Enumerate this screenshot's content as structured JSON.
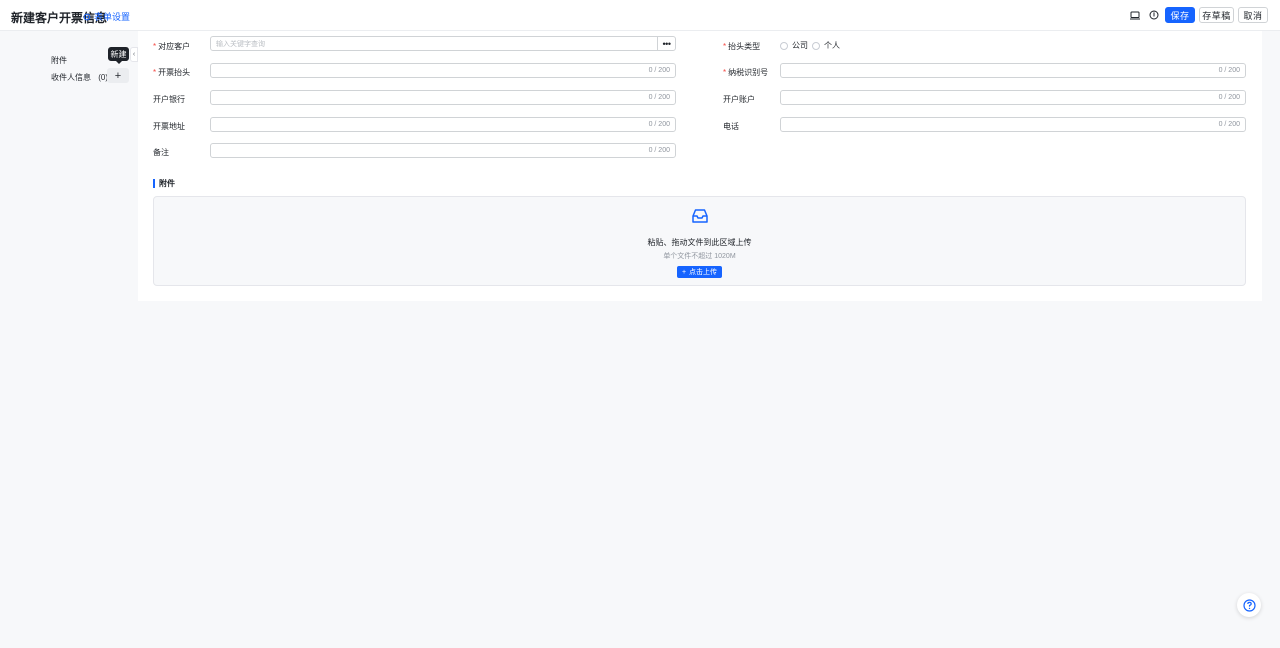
{
  "header": {
    "title": "新建客户开票信息",
    "form_settings": "表单设置",
    "save": "保存",
    "save_draft": "存草稿",
    "cancel": "取消"
  },
  "sidebar": {
    "items": [
      {
        "label": "附件"
      },
      {
        "label": "收件人信息",
        "count": "(0)"
      }
    ],
    "tooltip": "新建"
  },
  "form": {
    "customer": {
      "label": "对应客户",
      "placeholder": "输入关键字查询"
    },
    "title_type": {
      "label": "抬头类型",
      "options": [
        "公司",
        "个人"
      ]
    },
    "invoice_title": {
      "label": "开票抬头",
      "counter": "0 / 200"
    },
    "tax_id": {
      "label": "纳税识别号",
      "counter": "0 / 200"
    },
    "bank": {
      "label": "开户银行",
      "counter": "0 / 200"
    },
    "account": {
      "label": "开户账户",
      "counter": "0 / 200"
    },
    "address": {
      "label": "开票地址",
      "counter": "0 / 200"
    },
    "phone": {
      "label": "电话",
      "counter": "0 / 200"
    },
    "remark": {
      "label": "备注",
      "counter": "0 / 200"
    }
  },
  "attachments": {
    "section_title": "附件",
    "upload_title": "粘贴、拖动文件到此区域上传",
    "upload_hint": "单个文件不超过 1020M",
    "upload_button": "点击上传"
  },
  "colors": {
    "accent": "#1664ff",
    "required": "#f54a45"
  },
  "icons": [
    "gear-icon",
    "monitor-icon",
    "info-icon",
    "plus-icon",
    "chevron-left-icon",
    "more-icon",
    "inbox-icon",
    "help-icon"
  ]
}
